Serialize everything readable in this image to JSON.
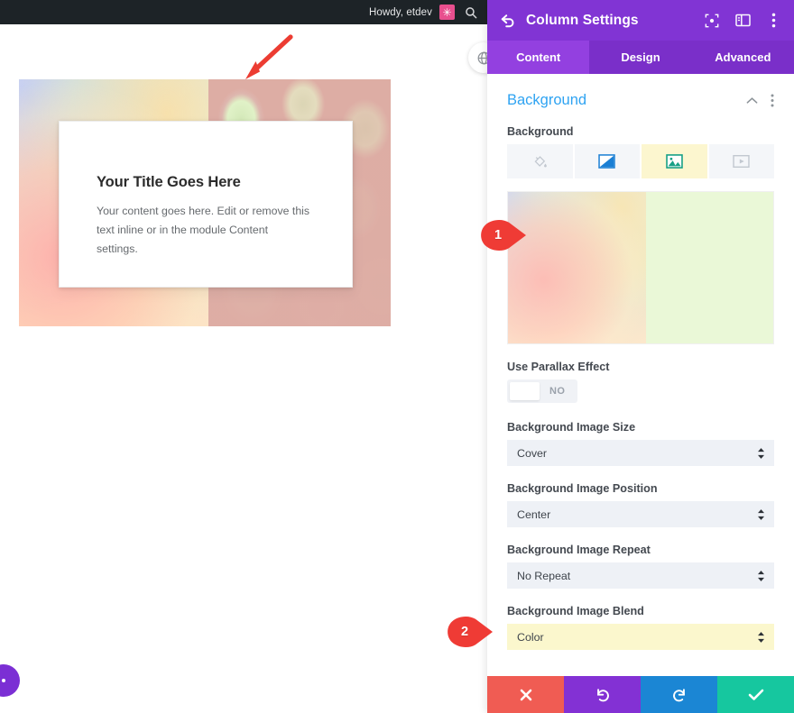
{
  "admin_bar": {
    "howdy": "Howdy, etdev",
    "avatar_icon": "star-avatar-icon",
    "search_icon": "search-icon"
  },
  "preview": {
    "card": {
      "title": "Your Title Goes Here",
      "body": "Your content goes here. Edit or remove this text inline or in the module Content settings."
    },
    "annotations": {
      "arrow_icon": "red-arrow-down-left-icon"
    },
    "fab_icon": "divi-floating-button-icon",
    "behind_icon": "globe-icon"
  },
  "panel": {
    "header": {
      "back_icon": "back-arrow-icon",
      "title": "Column Settings",
      "icons": [
        {
          "name": "focus-frame-icon"
        },
        {
          "name": "panel-layout-icon"
        },
        {
          "name": "more-vertical-icon"
        }
      ]
    },
    "tabs": [
      {
        "label": "Content",
        "active": true
      },
      {
        "label": "Design",
        "active": false
      },
      {
        "label": "Advanced",
        "active": false
      }
    ],
    "section": {
      "title": "Background",
      "collapse_icon": "chevron-up-icon",
      "menu_icon": "more-vertical-icon"
    },
    "background_field": {
      "label": "Background",
      "types": [
        {
          "name": "background-color-icon",
          "state": "inactive"
        },
        {
          "name": "background-gradient-icon",
          "state": "active"
        },
        {
          "name": "background-image-icon",
          "state": "selected"
        },
        {
          "name": "background-video-icon",
          "state": "inactive"
        }
      ]
    },
    "parallax": {
      "label": "Use Parallax Effect",
      "value": "NO"
    },
    "fields": [
      {
        "label": "Background Image Size",
        "value": "Cover",
        "highlight": false
      },
      {
        "label": "Background Image Position",
        "value": "Center",
        "highlight": false
      },
      {
        "label": "Background Image Repeat",
        "value": "No Repeat",
        "highlight": false
      },
      {
        "label": "Background Image Blend",
        "value": "Color",
        "highlight": true
      }
    ],
    "footer": [
      {
        "name": "cancel-button",
        "icon": "close-icon",
        "color": "#f05c53"
      },
      {
        "name": "undo-button",
        "icon": "undo-icon",
        "color": "#8331d4"
      },
      {
        "name": "redo-button",
        "icon": "redo-icon",
        "color": "#1b86d4"
      },
      {
        "name": "save-button",
        "icon": "check-icon",
        "color": "#16c79f"
      }
    ]
  },
  "markers": [
    {
      "number": "1"
    },
    {
      "number": "2"
    }
  ],
  "colors": {
    "panel_header": "#8134d4",
    "tab_bar": "#7a2fc9",
    "tab_active": "#9340e0",
    "section_title": "#2ea3f2",
    "highlight": "#fbf7cd",
    "marker": "#ef3b35"
  }
}
